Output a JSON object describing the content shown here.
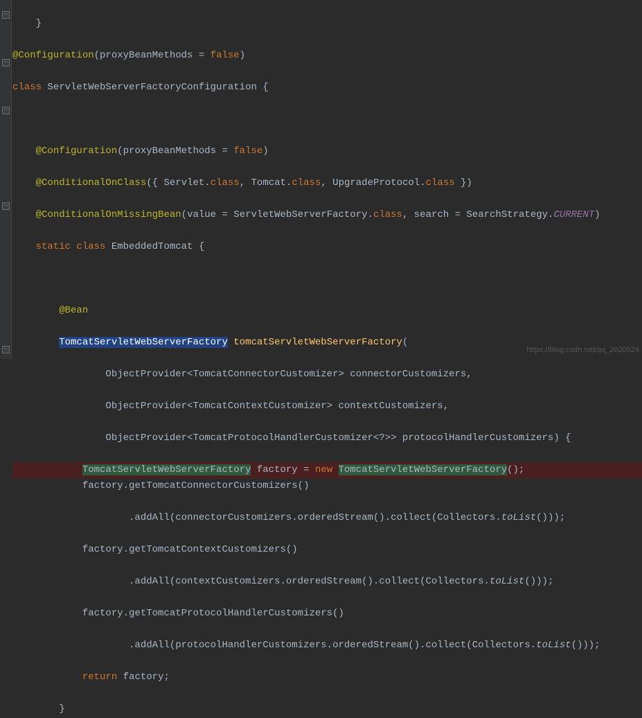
{
  "code": {
    "line0": {
      "end": "}"
    },
    "line1": {
      "ann": "@Configuration",
      "p1": "(",
      "param": "proxyBeanMethods",
      "eq": " = ",
      "val": "false",
      "p2": ")"
    },
    "line2": {
      "kw": "class ",
      "name": "ServletWebServerFactoryConfiguration",
      "brace": " {"
    },
    "line4": {
      "indent": "    ",
      "ann": "@Configuration",
      "p1": "(",
      "param": "proxyBeanMethods",
      "eq": " = ",
      "val": "false",
      "p2": ")"
    },
    "line5": {
      "indent": "    ",
      "ann": "@ConditionalOnClass",
      "p1": "({ ",
      "a": "Servlet",
      "dot": ".",
      "cls": "class",
      "c1": ", ",
      "b": "Tomcat",
      "c2": ", ",
      "c": "UpgradeProtocol",
      "p2": " })"
    },
    "line6": {
      "indent": "    ",
      "ann": "@ConditionalOnMissingBean",
      "p1": "(",
      "k1": "value",
      "eq": " = ",
      "a": "ServletWebServerFactory",
      "dot": ".",
      "cls": "class",
      "c1": ", ",
      "k2": "search",
      "eq2": " = ",
      "b": "SearchStrategy",
      "dot2": ".",
      "const": "CURRENT",
      "p2": ")"
    },
    "line7": {
      "indent": "    ",
      "kw1": "static ",
      "kw2": "class ",
      "name": "EmbeddedTomcat",
      "brace": " {"
    },
    "line9": {
      "indent": "        ",
      "ann": "@Bean"
    },
    "line10": {
      "indent": "        ",
      "type": "TomcatServletWebServerFactory",
      "sp": " ",
      "method": "tomcatServletWebServerFactory",
      "p1": "("
    },
    "line11": {
      "indent": "                ",
      "a": "ObjectProvider<TomcatConnectorCustomizer> connectorCustomizers,"
    },
    "line12": {
      "indent": "                ",
      "a": "ObjectProvider<TomcatContextCustomizer> contextCustomizers,"
    },
    "line13": {
      "indent": "                ",
      "a": "ObjectProvider<TomcatProtocolHandlerCustomizer<?>> protocolHandlerCustomizers) {"
    },
    "line14": {
      "indent": "            ",
      "type1": "TomcatServletWebServerFactory",
      "mid": " factory = ",
      "kw": "new ",
      "type2": "TomcatServletWebServerFactory",
      "end": "();"
    },
    "line15": {
      "indent": "            ",
      "a": "factory.getTomcatConnectorCustomizers()"
    },
    "line16": {
      "indent": "                    ",
      "a": ".addAll(connectorCustomizers.orderedStream().collect(Collectors.",
      "m": "toList",
      "b": "()));"
    },
    "line17": {
      "indent": "            ",
      "a": "factory.getTomcatContextCustomizers()"
    },
    "line18": {
      "indent": "                    ",
      "a": ".addAll(contextCustomizers.orderedStream().collect(Collectors.",
      "m": "toList",
      "b": "()));"
    },
    "line19": {
      "indent": "            ",
      "a": "factory.getTomcatProtocolHandlerCustomizers()"
    },
    "line20": {
      "indent": "                    ",
      "a": ".addAll(protocolHandlerCustomizers.orderedStream().collect(Collectors.",
      "m": "toList",
      "b": "()));"
    },
    "line21": {
      "indent": "            ",
      "kw": "return ",
      "a": "factory",
      "end": ";"
    },
    "line22": {
      "indent": "        ",
      "brace": "}"
    }
  },
  "fold_positions": [
    0,
    85,
    109,
    155,
    293,
    499
  ],
  "watermark": "https://blog.csdn.net/qq_2020524"
}
